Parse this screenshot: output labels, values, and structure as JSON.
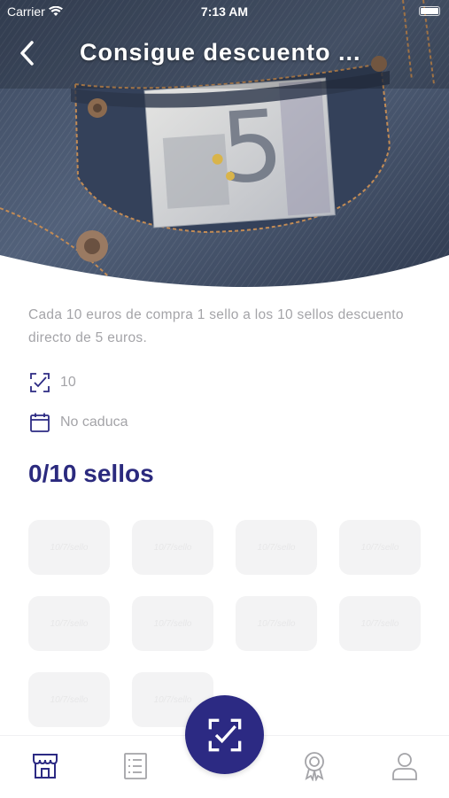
{
  "status_bar": {
    "carrier": "Carrier",
    "time": "7:13 AM"
  },
  "nav": {
    "title": "Consigue descuento ...",
    "back_icon": "chevron-left-icon"
  },
  "promotion": {
    "description": "Cada 10 euros de compra 1 sello a los 10 sellos descuento directo de 5 euros.",
    "stamps_required": "10",
    "expiry": "No caduca",
    "progress_label": "0/10 sellos"
  },
  "stamps": {
    "count": 10,
    "filled": 0,
    "placeholder_text": "10/7/sello"
  },
  "tab_bar": {
    "items": [
      "store-icon",
      "list-icon",
      "scan-stamp-icon",
      "award-icon",
      "profile-icon"
    ],
    "active": "store-icon"
  },
  "colors": {
    "accent": "#2c2a83",
    "title": "#2b2a7e",
    "muted_text": "#a4a4a8",
    "stamp_bg": "#f3f3f4"
  }
}
